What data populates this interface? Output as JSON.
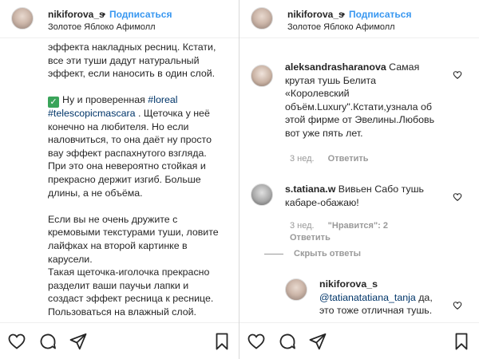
{
  "left_panel": {
    "header": {
      "username": "nikiforova_s",
      "dot": "•",
      "follow_label": "Подписаться",
      "location": "Золотое Яблоко Афимолл"
    },
    "caption_lines": [
      "эффекта накладных ресниц. Кстати,",
      "все эти туши дадут натуральный",
      "эффект, если наносить в один слой.",
      "",
      "Ну и проверенная |#loreal|",
      "|#telescopicmascara| . Щеточка у неё",
      "конечно на любителя. Но если",
      "наловчиться, то она даёт ну просто",
      "вау эффект распахнутого взгляда.",
      "При это она невероятно стойкая и",
      "прекрасно держит изгиб. Больше",
      "длины, а не объёма.",
      "",
      "Если вы не очень дружите с",
      "кремовыми текстурами туши, ловите",
      "лайфках на второй картинке в",
      "карусели.",
      "Такая щеточка-иголочка прекрасно",
      "разделит ваши паучьи лапки и",
      "создаст эффект ресница к реснице.",
      "Пользоваться на влажный слой."
    ],
    "caption": {
      "l1": "эффекта накладных ресниц. Кстати,",
      "l2": "все эти туши дадут натуральный",
      "l3": "эффект, если наносить в один слой.",
      "l5_text": "Ну и проверенная ",
      "l5_tag": "#loreal",
      "l6_tag": "#telescopicmascara",
      "l6_text": " . Щеточка у неё",
      "l7": "конечно на любителя. Но если",
      "l8": "наловчиться, то она даёт ну просто",
      "l9": "вау эффект распахнутого взгляда.",
      "l10": "При это она невероятно стойкая и",
      "l11": "прекрасно держит изгиб. Больше",
      "l12": "длины, а не объёма.",
      "l14": "Если вы не очень дружите с",
      "l15": "кремовыми текстурами туши, ловите",
      "l16": "лайфках на второй картинке в",
      "l17": "карусели.",
      "l18": "Такая щеточка-иголочка прекрасно",
      "l19": "разделит ваши паучьи лапки и",
      "l20": "создаст эффект ресница к реснице.",
      "l21": "Пользоваться на влажный слой."
    },
    "icons": [
      "heart-icon",
      "comment-icon",
      "share-icon",
      "bookmark-icon"
    ]
  },
  "right_panel": {
    "header": {
      "username": "nikiforova_s",
      "dot": "•",
      "follow_label": "Подписаться",
      "location": "Золотое Яблоко Афимолл"
    },
    "comments": {
      "c1": {
        "username": "aleksandrasharanova",
        "l1": " Самая",
        "l2": "крутая тушь Белита",
        "l3": "«Королевский",
        "l4": "объём.Luxury\".Кстати,узнала об",
        "l5": "этой фирме от Эвелины.Любовь",
        "l6": "вот уже пять лет.",
        "time": "3 нед.",
        "reply": "Ответить"
      },
      "c2": {
        "username": "s.tatiana.w",
        "l1": " Вивьен Сабо тушь",
        "l2": "кабаре-обажаю!",
        "time": "3 нед.",
        "likes": "\"Нравится\": 2",
        "reply": "Ответить",
        "hide_replies": "Скрыть ответы"
      },
      "c3": {
        "username": "nikiforova_s",
        "mention": "@tatianatatiana_tanja",
        "l1": " да,",
        "l2": "это тоже отличная тушь."
      }
    },
    "icons": [
      "heart-icon",
      "comment-icon",
      "share-icon",
      "bookmark-icon"
    ]
  },
  "colors": {
    "link_blue": "#3897f0",
    "hashtag": "#003569",
    "text": "#262626",
    "meta_gray": "#999999",
    "check_green": "#3aa45a"
  }
}
